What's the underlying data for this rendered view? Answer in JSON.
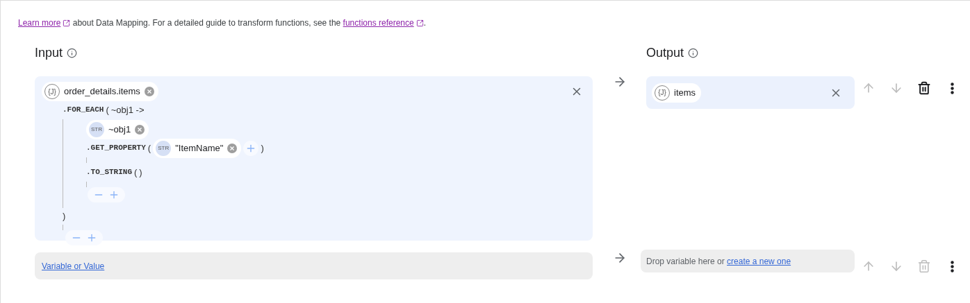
{
  "intro": [
    {
      "kind": "link",
      "text": "Learn more",
      "external": true
    },
    {
      "kind": "text",
      "text": " about Data Mapping. For a detailed guide to transform functions, see the "
    },
    {
      "kind": "link",
      "text": "functions reference",
      "external": true
    },
    {
      "kind": "text",
      "text": "."
    }
  ],
  "input_heading": "Input",
  "output_heading": "Output",
  "mappings": [
    {
      "kind": "expression",
      "input": {
        "root": {
          "kind": "json",
          "badge": "{J}",
          "name": "order_details.items"
        },
        "steps": [
          {
            "kind": "lambda",
            "name": ".FOR_EACH",
            "open": "(",
            "param": "~obj1 ->",
            "body": {
              "root": {
                "kind": "string",
                "badge": "STR",
                "name": "~obj1"
              },
              "steps": [
                {
                  "kind": "call",
                  "name": ".GET_PROPERTY",
                  "open": "(",
                  "args": [
                    {
                      "kind": "string",
                      "badge": "STR",
                      "name": "\"ItemName\""
                    }
                  ],
                  "close": ")"
                },
                {
                  "kind": "call",
                  "name": ".TO_STRING",
                  "open": "(",
                  "close": ")"
                }
              ]
            },
            "close": ")"
          }
        ]
      },
      "output": {
        "kind": "variable",
        "badge": "{J}",
        "name": "items"
      },
      "up_disabled": true,
      "down_disabled": true,
      "delete_disabled": false
    },
    {
      "kind": "empty",
      "input": {
        "link": "Variable or Value"
      },
      "output": {
        "kind": "drop",
        "text": "Drop variable here or ",
        "link": "create a new one"
      },
      "up_disabled": true,
      "down_disabled": true,
      "delete_disabled": true
    }
  ]
}
